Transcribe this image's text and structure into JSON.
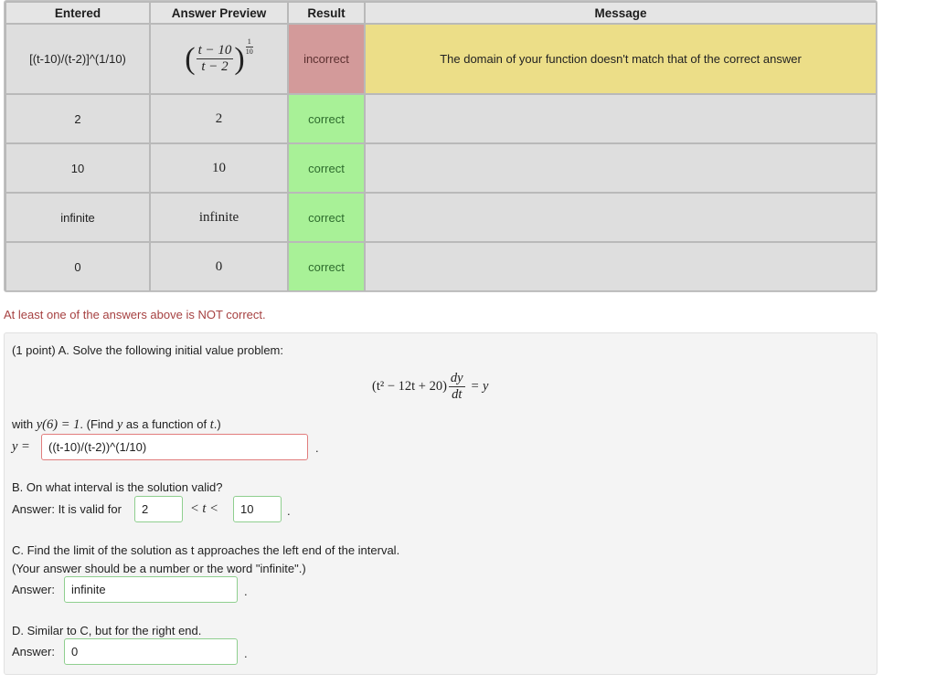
{
  "table": {
    "headers": {
      "entered": "Entered",
      "preview": "Answer Preview",
      "result": "Result",
      "message": "Message"
    },
    "rows": [
      {
        "entered": "[(t-10)/(t-2)]^(1/10)",
        "preview_num": "t − 10",
        "preview_den": "t − 2",
        "preview_exp_num": "1",
        "preview_exp_den": "10",
        "result": "incorrect",
        "message": "The domain of your function doesn't match that of the correct answer"
      },
      {
        "entered": "2",
        "preview": "2",
        "result": "correct",
        "message": ""
      },
      {
        "entered": "10",
        "preview": "10",
        "result": "correct",
        "message": ""
      },
      {
        "entered": "infinite",
        "preview": "infinite",
        "result": "correct",
        "message": ""
      },
      {
        "entered": "0",
        "preview": "0",
        "result": "correct",
        "message": ""
      }
    ]
  },
  "notice": "At least one of the answers above is NOT correct.",
  "problem": {
    "intro": "(1 point) A. Solve the following initial value problem:",
    "eq_lhs": "(t² − 12t + 20)",
    "eq_num": "dy",
    "eq_den": "dt",
    "eq_rhs": "= y",
    "cond_prefix": "with",
    "cond_math": "y(6) = 1",
    "cond_mid": ". (Find",
    "cond_var": "y",
    "cond_as": "as a function of",
    "cond_t": "t",
    "cond_end": ".)",
    "y_label": "y =",
    "y_value": "((t-10)/(t-2))^(1/10)",
    "b_question": "B. On what interval is the solution valid?",
    "b_answer_label": "Answer: It is valid for",
    "b_left": "2",
    "b_middle": "< t <",
    "b_right": "10",
    "c_question": "C. Find the limit of the solution as t approaches the left end of the interval.",
    "c_note": "(Your answer should be a number or the word \"infinite\".)",
    "c_answer_label": "Answer:",
    "c_value": "infinite",
    "d_question": "D. Similar to C, but for the right end.",
    "d_answer_label": "Answer:",
    "d_value": "0",
    "period": "."
  },
  "colors": {
    "incorrect": "#d39a9a",
    "correct": "#a8f197",
    "message_error": "#ecde88",
    "notice": "#a64141"
  }
}
